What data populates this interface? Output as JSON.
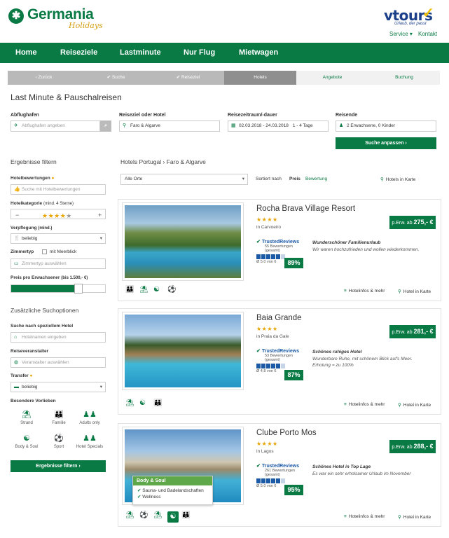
{
  "header": {
    "brand": "Germania",
    "brand_sub": "Holidays",
    "partner": "vtours",
    "partner_sub": "Urlaub, der passt",
    "service": "Service ▾",
    "contact": "Kontakt"
  },
  "nav": {
    "items": [
      "Home",
      "Reiseziele",
      "Lastminute",
      "Nur Flug",
      "Mietwagen"
    ]
  },
  "steps": [
    "‹ Zurück",
    "✔ Suche",
    "✔ Reiseziel",
    "Hotels",
    "Angebote",
    "Buchung"
  ],
  "page_title": "Last Minute & Pauschalreisen",
  "search": {
    "departure_label": "Abflughafen",
    "departure_placeholder": "Abflughafen angeben",
    "destination_label": "Reiseziel oder Hotel",
    "destination_value": "Faro & Algarve",
    "dates_label": "Reisezeitraum/-dauer",
    "dates_value": "02.03.2018 - 24.03.2018",
    "duration_value": "1 - 4 Tage",
    "travelers_label": "Reisende",
    "travelers_value": "2 Erwachsene, 0 Kinder",
    "submit": "Suche anpassen ›"
  },
  "filters": {
    "title": "Ergebnisse filtern",
    "ratings_label": "Hotelbewertungen",
    "ratings_placeholder": "Suche mit Hotelbewertungen",
    "category_label": "Hotelkategorie",
    "category_hint": "(mind. 4 Sterne)",
    "category_stars": 4,
    "board_label": "Verpflegung",
    "board_hint": "(mind.)",
    "board_value": "beliebig",
    "room_label": "Zimmertyp",
    "sea_view": "mit Meerblick",
    "room_placeholder": "Zimmertyp auswählen",
    "price_label": "Preis pro Erwachsener",
    "price_hint": "(bis 1.500,- €)",
    "price_fraction": 0.72,
    "more_title": "Zusätzliche Suchoptionen",
    "hotel_search_label": "Suche nach speziellem Hotel",
    "hotel_search_placeholder": "Hotelnamen eingeben",
    "operator_label": "Reiseveranstalter",
    "operator_placeholder": "Veranstalter auswählen",
    "transfer_label": "Transfer",
    "transfer_value": "beliebig",
    "prefs_label": "Besondere Vorlieben",
    "prefs": [
      "Strand",
      "Familie",
      "Adults only",
      "Body & Soul",
      "Sport",
      "Hotel Specials"
    ],
    "apply": "Ergebnisse filtern ›"
  },
  "results": {
    "breadcrumb_a": "Hotels Portugal",
    "breadcrumb_b": "Faro & Algarve",
    "location_select": "Alle Orte",
    "sort_label": "Sortiert nach",
    "sort_price": "Preis",
    "sort_rating": "Bewertung",
    "map_link": "Hotels in Karte",
    "info_link": "Hotelinfos & mehr",
    "map_card_link": "Hotel in Karte",
    "tr_label": "TrustedReviews",
    "price_prefix": "p.Erw. ab",
    "hotels": [
      {
        "name": "Rocha Brava Village Resort",
        "location": "in Carvoeiro",
        "price": "275,- €",
        "reviews": "55 Bewertungen",
        "reviews_sub": "(gesamt)",
        "score": "Ø 5.0 von 6",
        "percent": "89%",
        "review_title": "Wunderschöner Familienurlaub",
        "review_text": "Wir waren hochzufrieden und wollen wiederkommen."
      },
      {
        "name": "Baia Grande",
        "location": "in Praia da Gale",
        "price": "281,- €",
        "reviews": "53 Bewertungen",
        "reviews_sub": "(gesamt)",
        "score": "Ø 4.8 von 6",
        "percent": "87%",
        "review_title": "Schönes ruhiges Hotel",
        "review_text": "Wunderbare Ruhe, mit schönem Blick auf's Meer. Erholung = zu 100%"
      },
      {
        "name": "Clube Porto Mos",
        "location": "in Lagos",
        "price": "288,- €",
        "reviews": "261 Bewertungen",
        "reviews_sub": "(gesamt)",
        "score": "Ø 5.0 von 6",
        "percent": "95%",
        "review_title": "Schönes Hotel in Top Lage",
        "review_text": "Es war ein sehr erholsamer Urlaub im November"
      }
    ],
    "tooltip": {
      "title": "Body & Soul",
      "items": [
        "Sauna- und Badelandschaften",
        "Wellness"
      ]
    }
  },
  "colors": {
    "brand_green": "#0a7a45",
    "partner_blue": "#1c3f8a",
    "star": "#e8a300"
  }
}
